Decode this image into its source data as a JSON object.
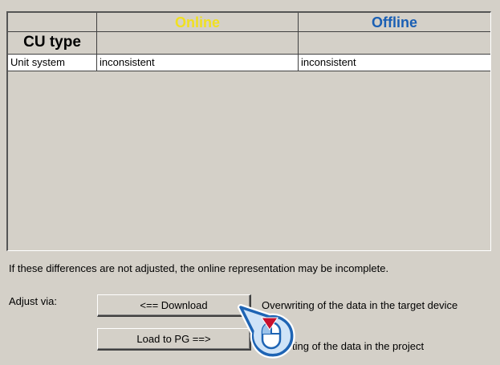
{
  "table": {
    "headers": [
      "",
      "Online",
      "Offline"
    ],
    "header_colors": {
      "online": "#f0e020",
      "offline": "#1a5fb4"
    },
    "row_header": "CU type",
    "rows": [
      {
        "param": "Unit system",
        "online": "inconsistent",
        "offline": "inconsistent"
      }
    ]
  },
  "note": "If these differences are not adjusted, the online representation may be incomplete.",
  "adjust_label": "Adjust via:",
  "buttons": {
    "download": "<== Download",
    "download_desc": "Overwriting of the data in the target device",
    "load_pg": "Load to PG ==>",
    "load_pg_desc": "ting of the data in the project"
  },
  "colors": {
    "dialog_bg": "#d4d0c8",
    "callout_blue": "#1e64b4",
    "callout_fill": "#cfe3f7",
    "pointer_red": "#c8102e"
  }
}
